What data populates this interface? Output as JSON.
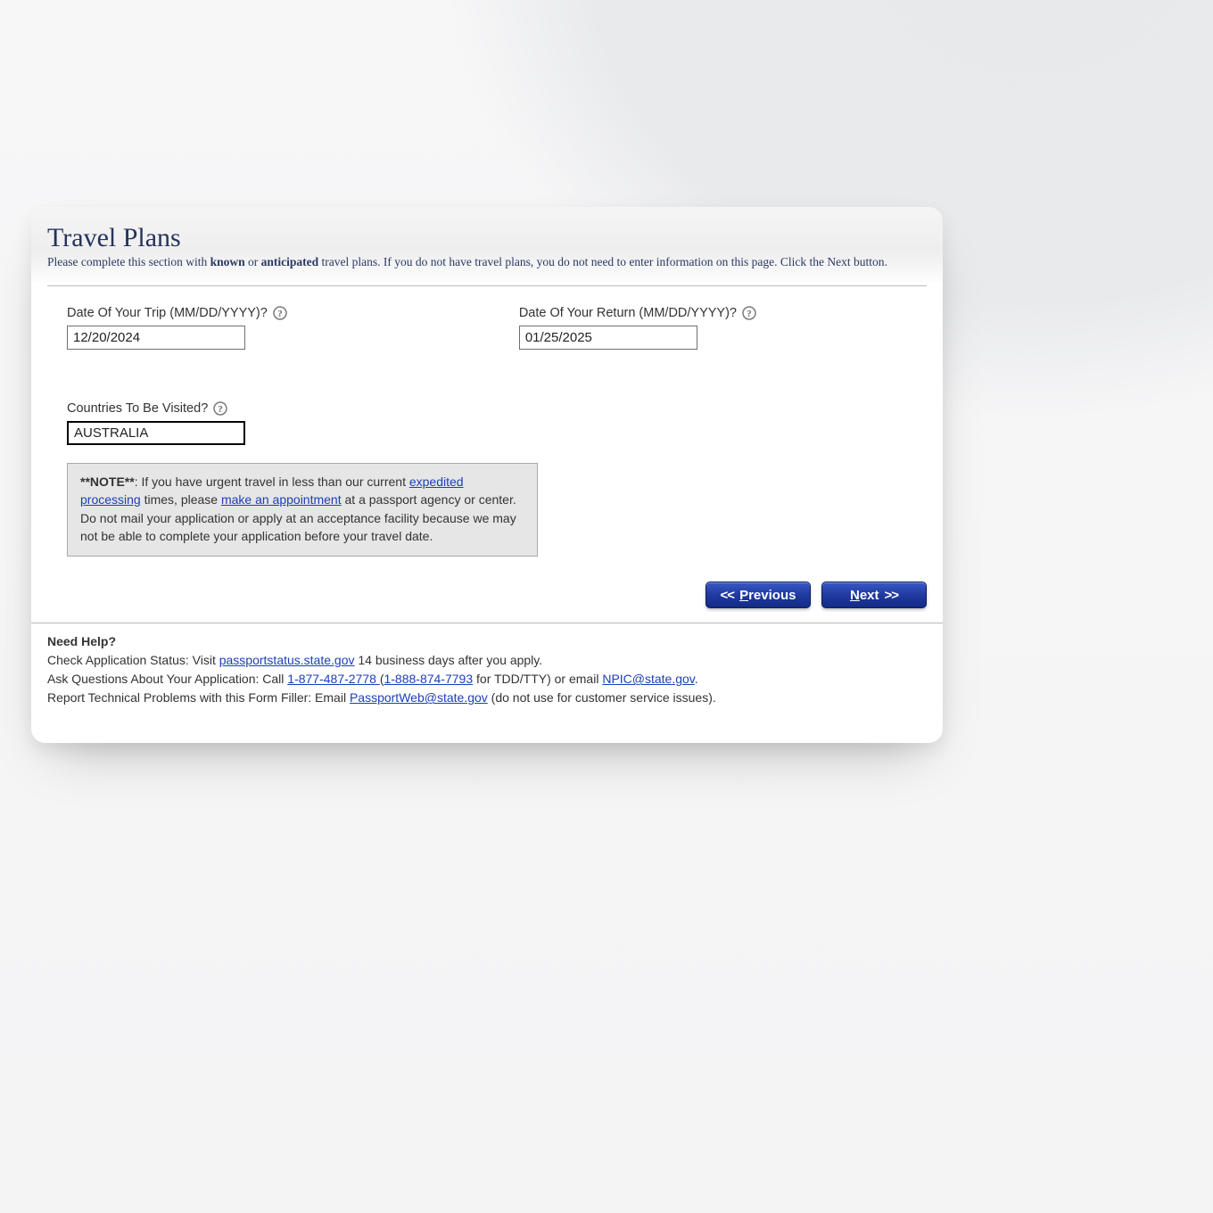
{
  "title": "Travel Plans",
  "subtitle": {
    "pre": "Please complete this section with ",
    "b1": "known",
    "mid": " or ",
    "b2": "anticipated",
    "post": " travel plans. If you do not have travel plans, you do not need to enter information on this page. Click the Next button."
  },
  "fields": {
    "trip": {
      "label": "Date Of Your Trip (MM/DD/YYYY)?",
      "value": "12/20/2024"
    },
    "return": {
      "label": "Date Of Your Return (MM/DD/YYYY)?",
      "value": "01/25/2025"
    },
    "countries": {
      "label": "Countries To Be Visited?",
      "value": "AUSTRALIA"
    }
  },
  "note": {
    "bold": "**NOTE**",
    "part1": ": If you have urgent travel in less than our current ",
    "link1": "expedited processing",
    "part2": " times, please ",
    "link2": "make an appointment",
    "part3": " at a passport agency or center. Do not mail your application or apply at an acceptance facility because we may not be able to complete your application before your travel date."
  },
  "buttons": {
    "prev_chev": "<<",
    "prev_initial": "P",
    "prev_rest": "revious",
    "next_initial": "N",
    "next_rest": "ext",
    "next_chev": ">>"
  },
  "help": {
    "heading": "Need Help?",
    "status_pre": "Check Application Status: Visit ",
    "status_link": "passportstatus.state.gov",
    "status_post": " 14 business days after you apply.",
    "ask_pre": "Ask Questions About Your Application: Call ",
    "ask_phone1": "1-877-487-2778 ",
    "ask_paren_open": "(",
    "ask_phone2": "1-888-874-7793",
    "ask_mid": " for TDD/TTY) or email ",
    "ask_email": "NPIC@state.gov",
    "ask_post": ".",
    "tech_pre": "Report Technical Problems with this Form Filler: Email ",
    "tech_email": "PassportWeb@state.gov",
    "tech_post": " (do not use for customer service issues)."
  }
}
